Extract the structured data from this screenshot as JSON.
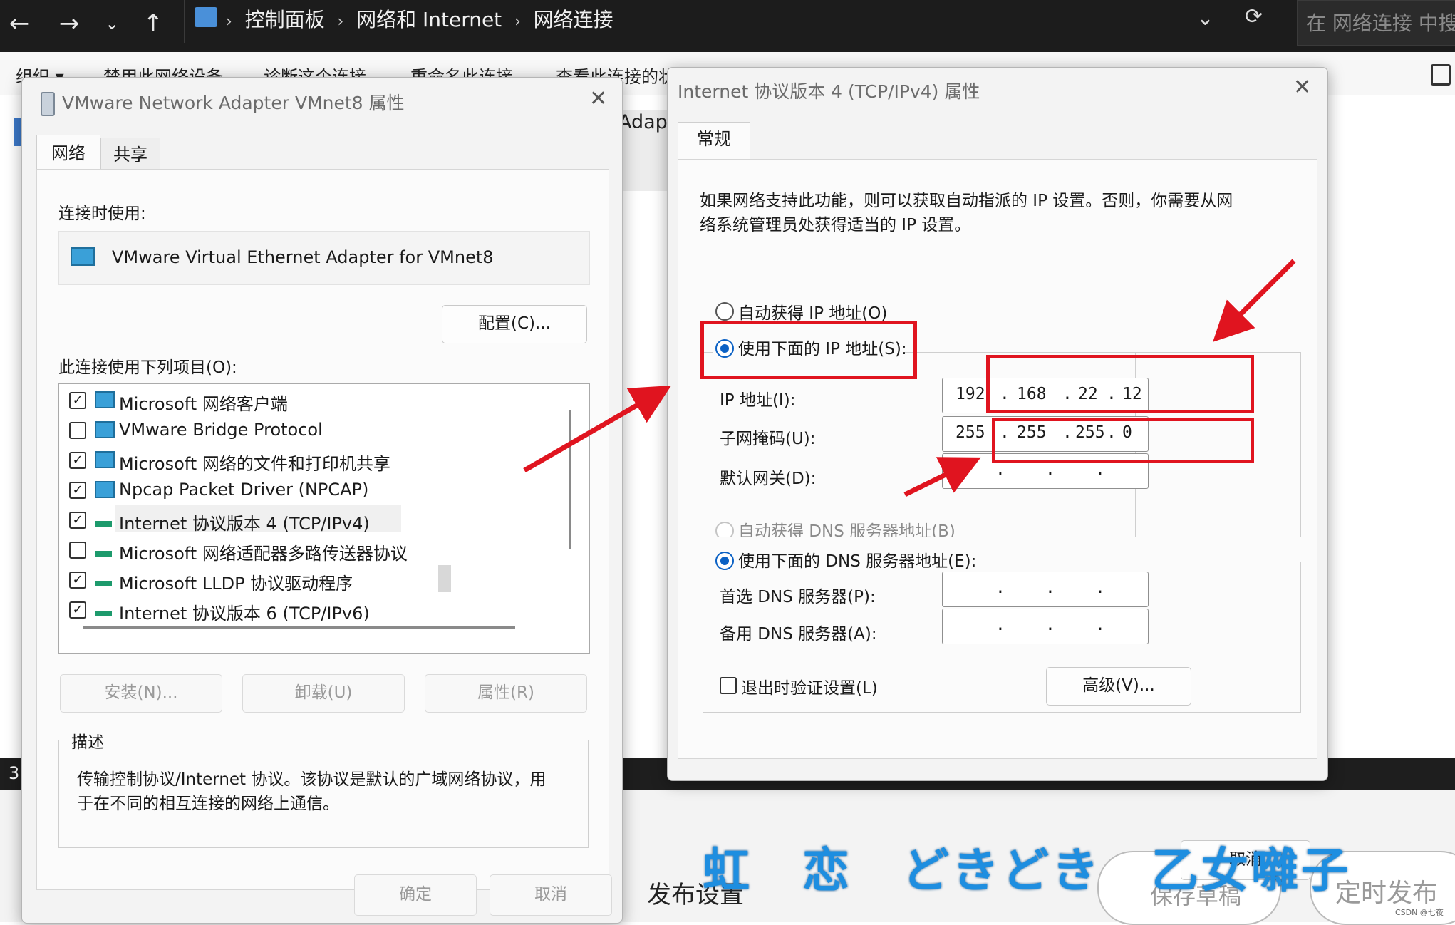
{
  "explorer": {
    "breadcrumb": [
      "控制面板",
      "网络和 Internet",
      "网络连接"
    ],
    "search_placeholder": "在 网络连接 中搜索",
    "commands": [
      "组织 ▾",
      "禁用此网络设备",
      "诊断这个连接",
      "重命名此连接",
      "查看此连接的状态"
    ],
    "bg_fragment": "Adapt",
    "status_left": "3",
    "publish_labels": [
      "发布设置",
      "保存草稿",
      "定时发布"
    ],
    "watermark": "CSDN @七夜"
  },
  "vmnet_dialog": {
    "title": "VMware Network Adapter VMnet8 属性",
    "tabs": [
      "网络",
      "共享"
    ],
    "connect_using_label": "连接时使用:",
    "adapter_name": "VMware Virtual Ethernet Adapter for VMnet8",
    "configure_button": "配置(C)...",
    "items_label": "此连接使用下列项目(O):",
    "items": [
      {
        "label": "Microsoft 网络客户端",
        "checked": true,
        "icon": "network-client-icon"
      },
      {
        "label": "VMware Bridge Protocol",
        "checked": false,
        "icon": "network-client-icon"
      },
      {
        "label": "Microsoft 网络的文件和打印机共享",
        "checked": true,
        "icon": "network-client-icon"
      },
      {
        "label": "Npcap Packet Driver (NPCAP)",
        "checked": true,
        "icon": "network-client-icon"
      },
      {
        "label": "Internet 协议版本 4 (TCP/IPv4)",
        "checked": true,
        "icon": "protocol-icon"
      },
      {
        "label": "Microsoft 网络适配器多路传送器协议",
        "checked": false,
        "icon": "protocol-icon"
      },
      {
        "label": "Microsoft LLDP 协议驱动程序",
        "checked": true,
        "icon": "protocol-icon"
      },
      {
        "label": "Internet 协议版本 6 (TCP/IPv6)",
        "checked": true,
        "icon": "protocol-icon"
      }
    ],
    "buttons": {
      "install": "安装(N)...",
      "uninstall": "卸载(U)",
      "properties": "属性(R)"
    },
    "description_label": "描述",
    "description_text_1": "传输控制协议/Internet 协议。该协议是默认的广域网络协议，用",
    "description_text_2": "于在不同的相互连接的网络上通信。",
    "ok": "确定",
    "cancel": "取消"
  },
  "ipv4_dialog": {
    "title": "Internet 协议版本 4 (TCP/IPv4) 属性",
    "tab": "常规",
    "intro_1": "如果网络支持此功能，则可以获取自动指派的 IP 设置。否则，你需要从网",
    "intro_2": "络系统管理员处获得适当的 IP 设置。",
    "auto_ip": "自动获得 IP 地址(O)",
    "manual_ip": "使用下面的 IP 地址(S):",
    "ip_label": "IP 地址(I):",
    "ip_value": [
      "192",
      "168",
      "22",
      "12"
    ],
    "mask_label": "子网掩码(U):",
    "mask_value": [
      "255",
      "255",
      "255",
      "0"
    ],
    "gateway_label": "默认网关(D):",
    "auto_dns": "自动获得 DNS 服务器地址(B)",
    "manual_dns": "使用下面的 DNS 服务器地址(E):",
    "dns_pref_label": "首选 DNS 服务器(P):",
    "dns_alt_label": "备用 DNS 服务器(A):",
    "validate_on_exit": "退出时验证设置(L)",
    "advanced_button": "高级(V)...",
    "cancel": "取消"
  },
  "overlay_banner": "虹　恋　どきどき　乙女囃子",
  "colors": {
    "annotation_red": "#e0141f",
    "radio_blue": "#0b61c4",
    "banner_blue": "#1e8ee0"
  }
}
